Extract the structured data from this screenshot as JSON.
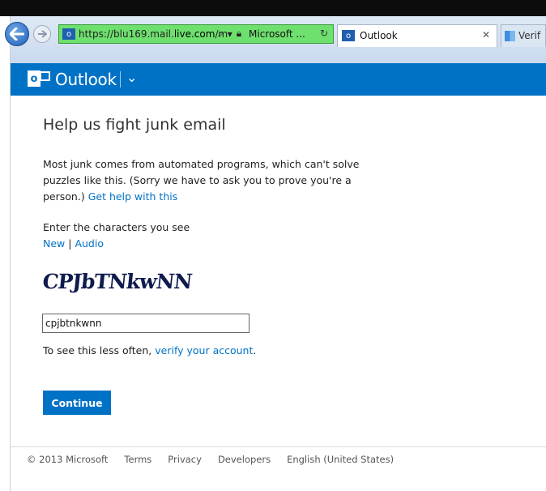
{
  "browser": {
    "address_url_prefix": "https://blu169.mail.",
    "address_url_host": "live.com",
    "address_url_suffix": "/m",
    "site_identity": "Microsoft ...",
    "active_tab_label": "Outlook",
    "second_tab_label": "Verif"
  },
  "header": {
    "app_name": "Outlook",
    "brand_color": "#0072c6"
  },
  "main": {
    "title": "Help us fight junk email",
    "para_line1": "Most junk comes from automated programs, which can't solve",
    "para_line2": "puzzles like this. (Sorry we have to ask you to prove you're a",
    "para_line3_prefix": "person.)",
    "help_link": "Get help with this",
    "enter_label": "Enter the characters you see",
    "new_link": "New",
    "link_separator": "|",
    "audio_link": "Audio",
    "captcha_text": "CPJbTNkwNN",
    "captcha_input_value": "cpjbtnkwnn",
    "less_often_prefix": "To see this less often,",
    "verify_link": "verify your account",
    "less_often_suffix": ".",
    "continue_label": "Continue"
  },
  "footer": {
    "copyright": "© 2013 Microsoft",
    "terms": "Terms",
    "privacy": "Privacy",
    "developers": "Developers",
    "language": "English (United States)"
  }
}
